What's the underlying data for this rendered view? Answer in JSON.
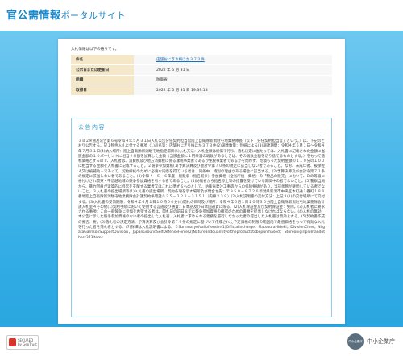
{
  "header": {
    "logo_main": "官公需情報",
    "logo_sub": "ポータルサイト"
  },
  "intro": "入札情報は以下の通りです。",
  "info": {
    "rows": [
      {
        "label": "件名",
        "value": "店舗おにぎり梅ほか３７３件",
        "is_link": true
      },
      {
        "label": "公示日または更新日",
        "value": "2022 年 5 月 31 日",
        "is_link": false
      },
      {
        "label": "組織",
        "value": "防衛省",
        "is_link": false
      },
      {
        "label": "取得日",
        "value": "2022 年 5 月 31 日 19:39:13",
        "is_link": false
      }
    ]
  },
  "notice": {
    "title": "公告内容",
    "body": "３８２※遡及公告第６号令和４年５月３１日入札公告分任契約担当官陸上自衛隊新潟駐屯地業務隊長（以下「分任契約担当官」という。）は、下記のとおり公告する。記１物件入札に付する事項（1)品名等：店舗おにぎり梅ほか３７３件(2)調達数量：別紙による(3)調達期間：令和４年６月１日～令和４年７月３１日(4)納入場所：陸上自衛隊新潟駐屯地指定場所(5)入札方法：入札金額は総価で行う。落札決定に当たっては、入札書に記載された金額に当該金額の１０パーセントに相当する額を加算した金額（当該金額に１円未満の端数があるときは、その端数金額を切り捨てるものとする。）をもって落札価格とするので、入札者は、消費税及び地方消費税に係る課税事業者であるか免税事業者であるかを問わず、見積もった契約金額の１１０分の１００に相当する金額を入札書に記載すること。２競争参加資格(1)予算決算及び会計令第７０条の規定に該当しない者であること。なお、未成年者、被保佐人又は被補助人であって、契約締結のために必要な同意を得ている者は、同条中、特別の理由がある場合に該当する。(2)予算決算及び会計令第７１条の規定に該当しない者であること。(3)令和４・５・６年度一般競争（指名競争）参加資格（全省庁統一資格）の「物品の販売」において、Ｄの等級に格付けされ関東・甲信越地域の競争参加資格を有する者であること。(4)防衛省から指名停止等の措置を受けている期間中の者でないこと。(5)警察当局から、暴力団員が実質的に経営を支配する業者又はこれに準ずるものとして、防衛省発注工事等からの排除要請があり、当該状態が継続している者でないこと。３入札書の提出場所等(1)入札書の提出場所、契約条項を示す場所及び問合せ先：〒９５０－８７２６新潟県新潟市中央区本町通１番町１８８番地陸上自衛隊新潟駐屯地業務隊会計課契約係電話０２５－２２２－３１５１（内線２３９）(2)入札説明書の交付方法：上記３(1)の交付場所にて交付する。(3)入札書の受領期限：令和４年６月１日１０時００分(4)開札の日時及び場所：令和４年６月１日１０時３０分陸上自衛隊新潟駐屯地業務隊会計課入札室４その他(1)契約手続において使用する言語及び通貨：日本語及び日本国通貨に限る。(2)入札保証金及び契約保証金：免除。(3)入札者に要求される事項：この一般競争に参加を希望する者は、開札日の前日までに競争参加資格の確認のための書類を提出しなければならない。(4)入札の無効：本公告に示した競争参加資格のない者の提出した入札書、入札者に求められる義務を履行しなかった者の提出した入札書は無効とする。(5)契約書作成の要否：要。(6)落札者の決定方法：予算決算及び会計令第７９条の規定に基づいて作成された予定価格の制限の範囲内で最低価格をもって有効な入札を行った者を落札者とする。(7)詳細は入札説明書による。５Summaryofcalloftender(1)Officialincharge：MatsuuraHideki，DivisionChief，NiigataGarrisonSupportDivision，JapanGroundSelfDefenseForce(2)Natureandquantityoftheproductstobepurchased：Storeonigiriplumandothers373items"
  },
  "footer": {
    "badge_line1": "SECURED",
    "badge_line2": "by GeoTrust",
    "smb_mark": "中小企業庁",
    "smb_label": "中小企業庁"
  }
}
